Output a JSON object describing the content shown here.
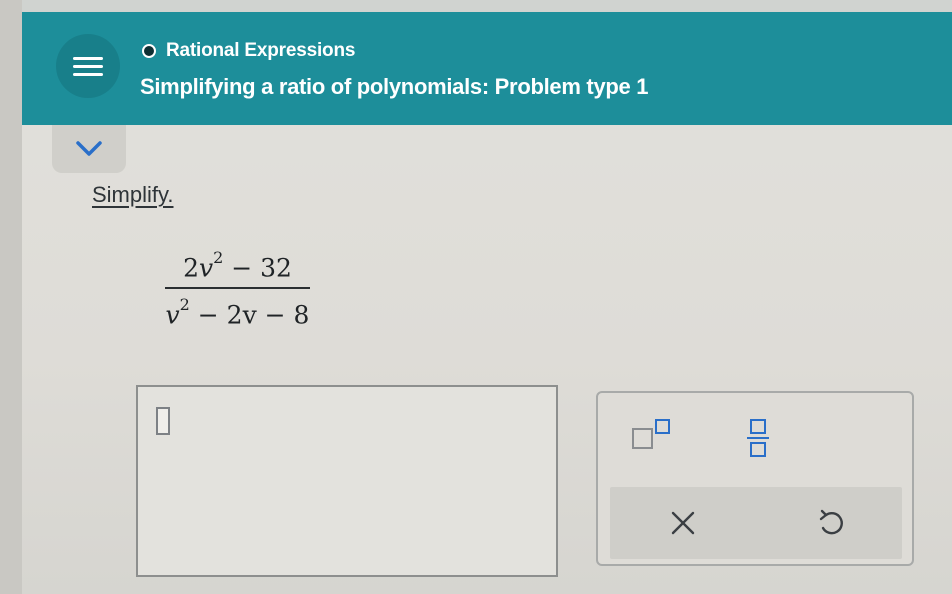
{
  "header": {
    "topic_title": "Rational Expressions",
    "problem_title": "Simplifying a ratio of polynomials: Problem type 1",
    "menu_icon": "hamburger-menu-icon",
    "topic_icon": "radio-dot-icon",
    "background_color": "#1d8e9a"
  },
  "collapse": {
    "icon": "chevron-down-icon",
    "color": "#2a6fc9"
  },
  "problem": {
    "instruction": "Simplify.",
    "expression": {
      "numerator": {
        "coef": "2",
        "var": "v",
        "exp": "2",
        "rest": " − 32"
      },
      "denominator": {
        "var": "v",
        "exp": "2",
        "rest": " − 2v − 8"
      }
    }
  },
  "answer": {
    "value": ""
  },
  "keypad": {
    "keys": [
      {
        "name": "exponent-key",
        "icon": "exponent-template-icon"
      },
      {
        "name": "fraction-key",
        "icon": "fraction-template-icon"
      }
    ],
    "actions": [
      {
        "name": "clear-button",
        "icon": "close-icon",
        "glyph": "×"
      },
      {
        "name": "undo-button",
        "icon": "undo-icon",
        "glyph": "↺"
      }
    ]
  }
}
